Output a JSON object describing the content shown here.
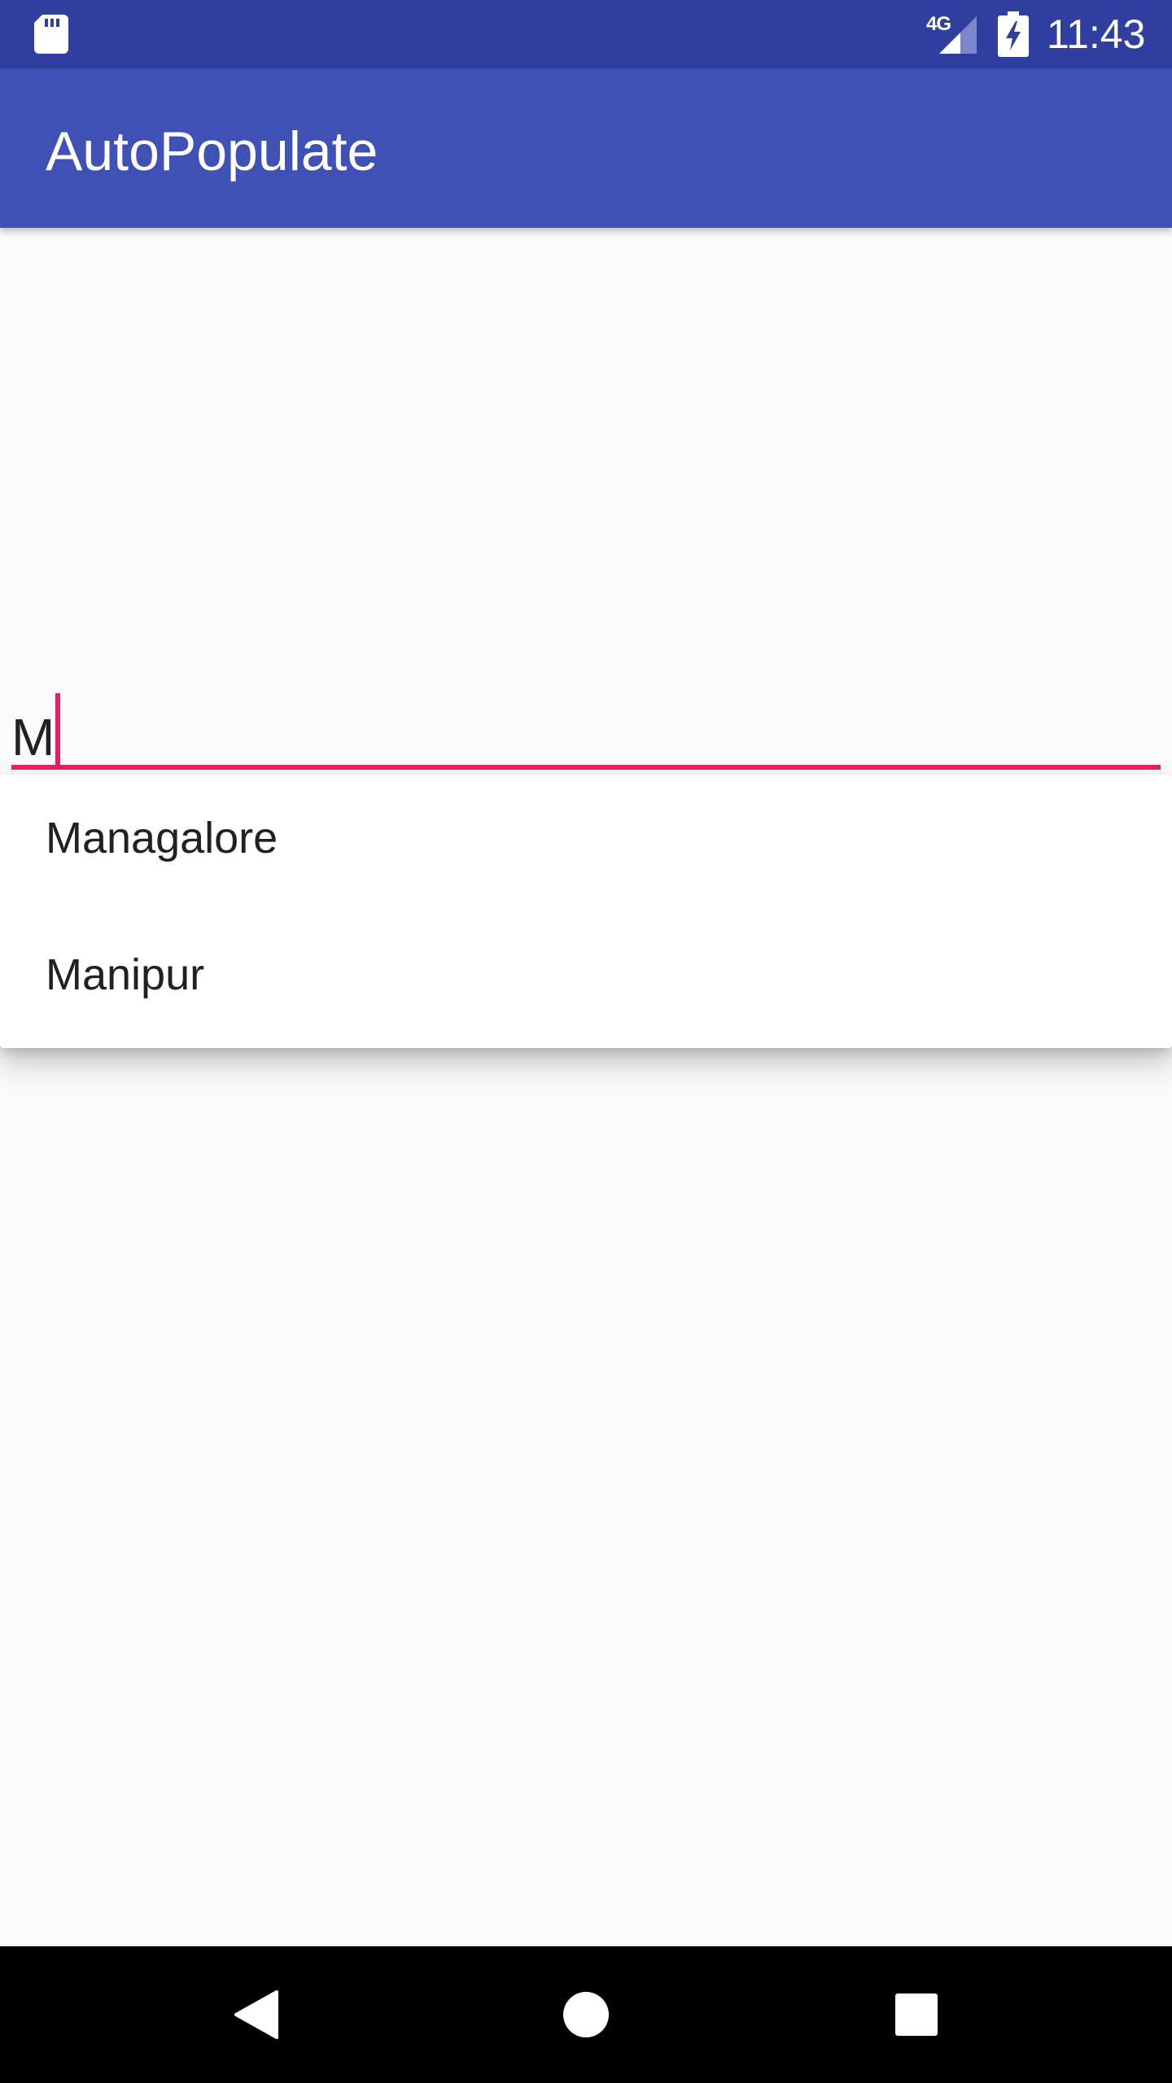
{
  "status_bar": {
    "network_label": "4G",
    "time": "11:43",
    "icons": [
      "sd-card-icon",
      "cellular-signal-icon",
      "battery-charging-icon"
    ]
  },
  "app_bar": {
    "title": "AutoPopulate"
  },
  "text_field": {
    "value": "M",
    "accent_color": "#E91E63"
  },
  "dropdown": {
    "items": [
      {
        "label": "Managalore"
      },
      {
        "label": "Manipur"
      }
    ]
  },
  "nav_bar": {
    "icons": [
      "back-icon",
      "home-icon",
      "recents-icon"
    ]
  },
  "colors": {
    "status_bar": "#303F9F",
    "app_bar": "#3F51B5",
    "background": "#FAFAFA",
    "accent": "#E91E63",
    "nav_bar": "#000000"
  }
}
